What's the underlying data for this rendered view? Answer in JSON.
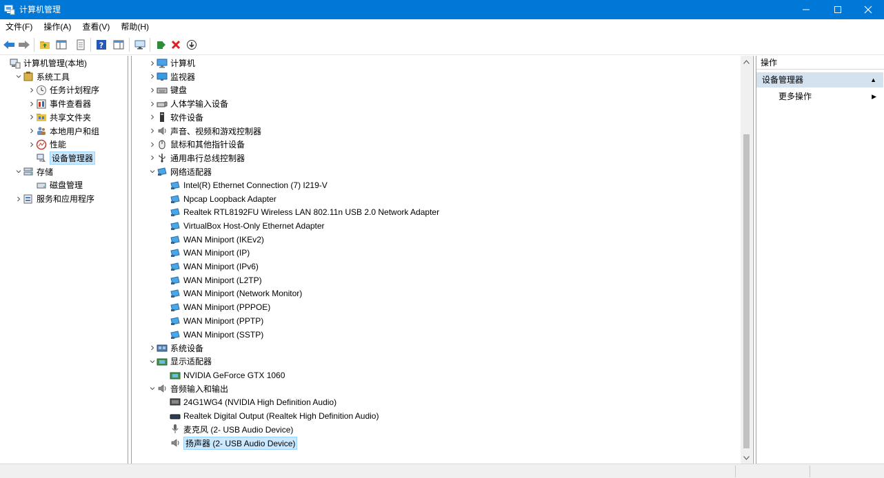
{
  "window": {
    "title": "计算机管理",
    "minimize_icon": "minimize-icon",
    "maximize_icon": "maximize-icon",
    "close_icon": "close-icon"
  },
  "menu": [
    {
      "label": "文件(F)"
    },
    {
      "label": "操作(A)"
    },
    {
      "label": "查看(V)"
    },
    {
      "label": "帮助(H)"
    }
  ],
  "toolbar": {
    "icons": [
      "back-arrow-icon",
      "forward-arrow-icon",
      "up-folder-icon",
      "show-tree-icon",
      "properties-icon",
      "help-icon",
      "show-action-pane-icon",
      "monitor-icon",
      "update-driver-icon",
      "uninstall-x-icon",
      "download-icon"
    ]
  },
  "left_tree": [
    {
      "label": "计算机管理(本地)",
      "level": 0,
      "expander": "",
      "icon": "computer-management-icon"
    },
    {
      "label": "系统工具",
      "level": 1,
      "expander": "v",
      "icon": "tools-icon"
    },
    {
      "label": "任务计划程序",
      "level": 2,
      "expander": ">",
      "icon": "clock-icon"
    },
    {
      "label": "事件查看器",
      "level": 2,
      "expander": ">",
      "icon": "event-viewer-icon"
    },
    {
      "label": "共享文件夹",
      "level": 2,
      "expander": ">",
      "icon": "shared-folder-icon"
    },
    {
      "label": "本地用户和组",
      "level": 2,
      "expander": ">",
      "icon": "users-icon"
    },
    {
      "label": "性能",
      "level": 2,
      "expander": ">",
      "icon": "performance-icon"
    },
    {
      "label": "设备管理器",
      "level": 2,
      "expander": "",
      "icon": "device-manager-icon",
      "selected": true
    },
    {
      "label": "存储",
      "level": 1,
      "expander": "v",
      "icon": "storage-icon"
    },
    {
      "label": "磁盘管理",
      "level": 2,
      "expander": "",
      "icon": "disk-icon"
    },
    {
      "label": "服务和应用程序",
      "level": 1,
      "expander": ">",
      "icon": "services-icon"
    }
  ],
  "device_tree": [
    {
      "label": "计算机",
      "level": 0,
      "expander": ">",
      "icon": "computer-icon"
    },
    {
      "label": "监视器",
      "level": 0,
      "expander": ">",
      "icon": "monitor-icon"
    },
    {
      "label": "键盘",
      "level": 0,
      "expander": ">",
      "icon": "keyboard-icon"
    },
    {
      "label": "人体学输入设备",
      "level": 0,
      "expander": ">",
      "icon": "hid-icon"
    },
    {
      "label": "软件设备",
      "level": 0,
      "expander": ">",
      "icon": "software-device-icon"
    },
    {
      "label": "声音、视频和游戏控制器",
      "level": 0,
      "expander": ">",
      "icon": "speaker-icon"
    },
    {
      "label": "鼠标和其他指针设备",
      "level": 0,
      "expander": ">",
      "icon": "mouse-icon"
    },
    {
      "label": "通用串行总线控制器",
      "level": 0,
      "expander": ">",
      "icon": "usb-icon"
    },
    {
      "label": "网络适配器",
      "level": 0,
      "expander": "v",
      "icon": "network-adapter-icon"
    },
    {
      "label": "Intel(R) Ethernet Connection (7) I219-V",
      "level": 1,
      "expander": "",
      "icon": "network-adapter-icon"
    },
    {
      "label": "Npcap Loopback Adapter",
      "level": 1,
      "expander": "",
      "icon": "network-adapter-icon"
    },
    {
      "label": "Realtek RTL8192FU Wireless LAN 802.11n USB 2.0 Network Adapter",
      "level": 1,
      "expander": "",
      "icon": "network-adapter-icon"
    },
    {
      "label": "VirtualBox Host-Only Ethernet Adapter",
      "level": 1,
      "expander": "",
      "icon": "network-adapter-icon"
    },
    {
      "label": "WAN Miniport (IKEv2)",
      "level": 1,
      "expander": "",
      "icon": "network-adapter-icon"
    },
    {
      "label": "WAN Miniport (IP)",
      "level": 1,
      "expander": "",
      "icon": "network-adapter-icon"
    },
    {
      "label": "WAN Miniport (IPv6)",
      "level": 1,
      "expander": "",
      "icon": "network-adapter-icon"
    },
    {
      "label": "WAN Miniport (L2TP)",
      "level": 1,
      "expander": "",
      "icon": "network-adapter-icon"
    },
    {
      "label": "WAN Miniport (Network Monitor)",
      "level": 1,
      "expander": "",
      "icon": "network-adapter-icon"
    },
    {
      "label": "WAN Miniport (PPPOE)",
      "level": 1,
      "expander": "",
      "icon": "network-adapter-icon"
    },
    {
      "label": "WAN Miniport (PPTP)",
      "level": 1,
      "expander": "",
      "icon": "network-adapter-icon"
    },
    {
      "label": "WAN Miniport (SSTP)",
      "level": 1,
      "expander": "",
      "icon": "network-adapter-icon"
    },
    {
      "label": "系统设备",
      "level": 0,
      "expander": ">",
      "icon": "system-device-icon"
    },
    {
      "label": "显示适配器",
      "level": 0,
      "expander": "v",
      "icon": "display-adapter-icon"
    },
    {
      "label": "NVIDIA GeForce GTX 1060",
      "level": 1,
      "expander": "",
      "icon": "display-adapter-icon"
    },
    {
      "label": "音频输入和输出",
      "level": 0,
      "expander": "v",
      "icon": "speaker-icon"
    },
    {
      "label": "24G1WG4 (NVIDIA High Definition Audio)",
      "level": 1,
      "expander": "",
      "icon": "monitor-audio-icon"
    },
    {
      "label": "Realtek Digital Output (Realtek High Definition Audio)",
      "level": 1,
      "expander": "",
      "icon": "digital-output-icon"
    },
    {
      "label": "麦克风 (2- USB Audio Device)",
      "level": 1,
      "expander": "",
      "icon": "microphone-icon"
    },
    {
      "label": "扬声器 (2- USB Audio Device)",
      "level": 1,
      "expander": "",
      "icon": "speaker-icon",
      "selected": true
    }
  ],
  "actions": {
    "header": "操作",
    "section": "设备管理器",
    "item": "更多操作"
  },
  "colors": {
    "titlebar": "#0078d7",
    "selection": "#cce8ff",
    "action_section": "#d4e1ef"
  }
}
